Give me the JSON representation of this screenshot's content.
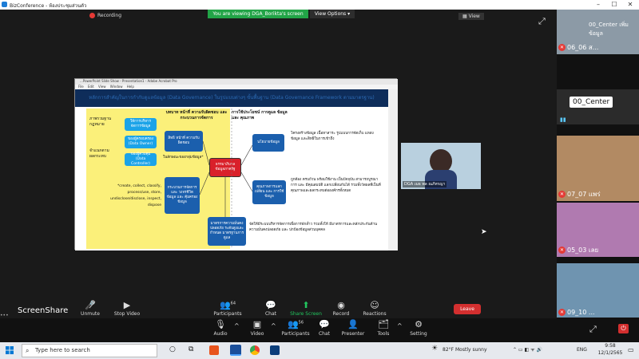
{
  "window": {
    "title": "BizConference - ห้องประชุมส่วนตัว"
  },
  "stage": {
    "recording": "Recording",
    "banner": "You are viewing DGA_Borikta's screen",
    "view_options": "View Options ▾",
    "view_button": "View"
  },
  "shared": {
    "window_title": "...PowerPoint Slide Show - Presentation1 - Adobe Acrobat Pro",
    "menu": "File Edit View Window Help",
    "slide": {
      "heading": "หลักการสำคัญในการกำกับดูแลข้อมูล (Data Governance) ในรูปแบบต่างๆ ขั้นพื้นฐาน (Data Governance Framework ตามมาตรฐาน)",
      "left_label_1": "ภาพรวมฐาน กฎหมาย",
      "left_label_2": "จำแนกตาม ผลกระทบ",
      "col_header_left": "บทบาท หน้าที่ ความรับผิดชอบ และ กระบวนการจัดการ",
      "col_header_right": "การใช้ประโยชน์ การดูแล ข้อมูล และ คุณภาพ",
      "cyan_1": "ให้การบริหาร จัดการข้อมูล",
      "cyan_2": "ของผู้ครอบครอง (Data Owner)",
      "cyan_3": "ของผู้ควบคุม (Data Controller)",
      "blue_left_1": "สิทธิ หน้าที่ ความรับผิดชอบ",
      "blue_left_note": "ในลักษณะของกลุ่มข้อมูล*",
      "blue_left_2": "กระบวนการจัดการ และ วงจรชีวิต ข้อมูล และ คุ้มครองข้อมูล",
      "verbs": "*create, collect, classify, process/use, store, undisclose/disclose, inspect, dispose",
      "center": "ธรรมาภิบาล ข้อมูลภาครัฐ",
      "blue_right_1": "นโยบายข้อมูล",
      "right_text_1": "โครงสร้างข้อมูล เนื้อหาสาระ รูปแบบการจัดเก็บ แหล่งข้อมูล และสิทธิในการเข้าถึง",
      "blue_right_2": "คุณภาพการแลกเปลี่ยน และ การใช้ ข้อมูล",
      "right_text_2": "ถูกต้อง ครบถ้วน พร้อมใช้งาน เป็นปัจจุบัน สามารถบูรณาการ และ มีคุณสมบัติ แลกเปลี่ยนกันได้ รวมทั้งวัดผลที่เป็นที่ คุณภาพและผลกระทบต่อองค์กรทั้งหมด",
      "blue_bottom": "มาตรการความมั่นคงปลอดภัย ระดับสูงและกำหนด มาตรฐานการดูแล",
      "bottom_text": "จัดให้มีระบบบริหารจัดการเพื่อการพักลํ่าว รวมทั้งให้ มีมาตรการและหลักประกันด้านความมั่นคงปลอดภัย และ ปกป้องข้อมูลส่วนบุคคล"
    }
  },
  "camera": {
    "name": "DGA เมธ พล ณภัทรญา"
  },
  "sidebar": {
    "top_label": "00_Center เพิ่มข้อมูล",
    "tiles": [
      {
        "label": "06_06 ส..."
      },
      {
        "label": "00_Center"
      },
      {
        "label": "07_07 แพร่"
      },
      {
        "label": "05_03 เลย"
      },
      {
        "label": "09_10 ..."
      }
    ]
  },
  "share_controls": {
    "screenshare_label": "ScreenShare",
    "unmute": "Unmute",
    "stop_video": "Stop Video",
    "participants": "Participants",
    "participants_count": "64",
    "chat": "Chat",
    "share_screen": "Share Screen",
    "record": "Record",
    "reactions": "Reactions",
    "leave": "Leave"
  },
  "bottom": {
    "audio": "Audio",
    "video": "Video",
    "participants": "Participants",
    "participants_count": "56",
    "chat": "Chat",
    "presenter": "Presenter",
    "tools": "Tools",
    "setting": "Setting"
  },
  "taskbar": {
    "search_placeholder": "Type here to search",
    "weather": "82°F  Mostly sunny",
    "lang": "ENG",
    "time": "9:58",
    "date": "12/1/2565"
  }
}
